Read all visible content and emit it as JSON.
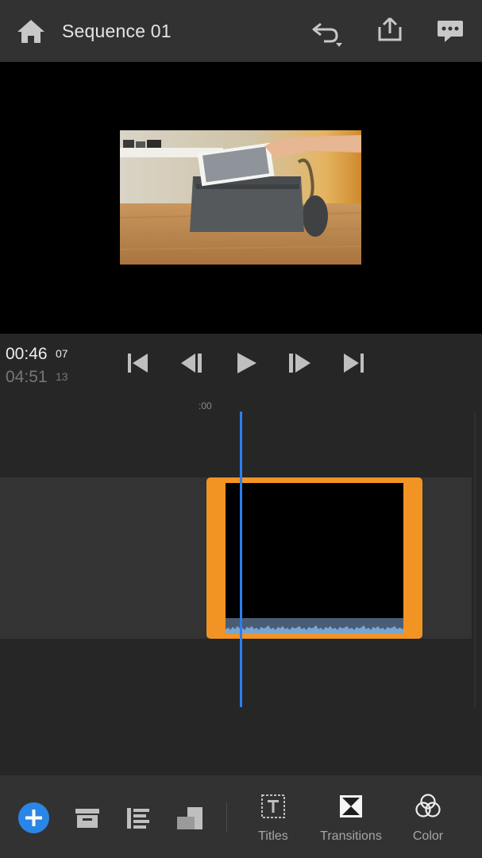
{
  "header": {
    "title": "Sequence 01",
    "icons": [
      "home-icon",
      "undo-icon",
      "share-icon",
      "comment-icon"
    ]
  },
  "preview": {
    "frame_description_icon": "video-preview-frame"
  },
  "transport": {
    "current_time": "00:46",
    "current_frames": "07",
    "total_time": "04:51",
    "total_frames": "13",
    "controls": [
      "go-to-start-icon",
      "step-back-icon",
      "play-icon",
      "step-forward-icon",
      "go-to-end-icon"
    ]
  },
  "timeline": {
    "ruler_label": ":00",
    "clip_color": "#f29423",
    "playhead_color": "#2d7ff0"
  },
  "toolbar": {
    "accent": "#2a86e6",
    "titles_label": "Titles",
    "transitions_label": "Transitions",
    "color_label": "Color"
  }
}
